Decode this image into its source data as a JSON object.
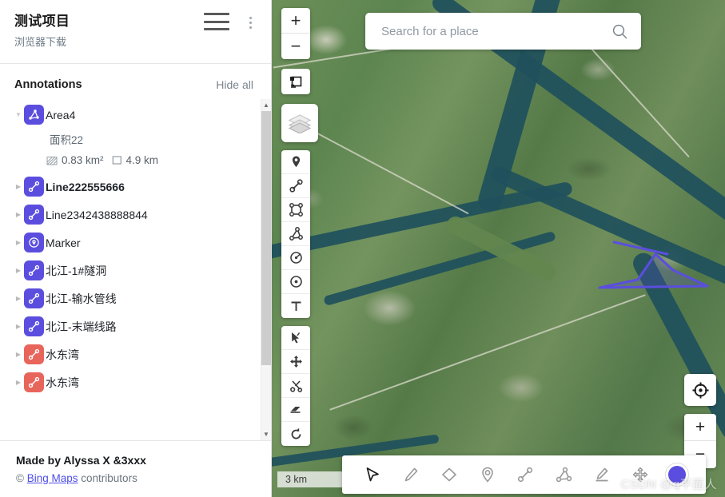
{
  "sidebar": {
    "project_title": "测试项目",
    "project_subtitle": "浏览器下载",
    "menu_icon": "hamburger-icon",
    "more_icon": "kebab-menu-icon",
    "annotations_heading": "Annotations",
    "hide_all_label": "Hide all",
    "items": [
      {
        "label": "Area4",
        "icon": "polygon-icon",
        "color": "#5b4ede",
        "expanded": true,
        "bold": false,
        "detail": {
          "note": "面积22",
          "area_value": "0.83 km²",
          "area_icon": "area-hatch-icon",
          "length_value": "4.9 km",
          "length_icon": "perimeter-square-icon"
        }
      },
      {
        "label": "Line222555666",
        "icon": "line-icon",
        "color": "#5b4ede",
        "expanded": false,
        "bold": true
      },
      {
        "label": "Line2342438888844",
        "icon": "line-icon",
        "color": "#5b4ede",
        "expanded": false,
        "bold": false
      },
      {
        "label": "Marker",
        "icon": "marker-pin-icon",
        "color": "#5b4ede",
        "expanded": false,
        "bold": false
      },
      {
        "label": "北江-1#隧洞",
        "icon": "line-icon",
        "color": "#5b4ede",
        "expanded": false,
        "bold": false
      },
      {
        "label": "北江-输水管线",
        "icon": "line-icon",
        "color": "#5b4ede",
        "expanded": false,
        "bold": false
      },
      {
        "label": "北江-末端线路",
        "icon": "line-icon",
        "color": "#5b4ede",
        "expanded": false,
        "bold": false
      },
      {
        "label": "水东湾",
        "icon": "line-icon",
        "color": "#e8655c",
        "expanded": false,
        "bold": false
      },
      {
        "label": "水东湾",
        "icon": "line-icon",
        "color": "#e8655c",
        "expanded": false,
        "bold": false
      }
    ],
    "footer": {
      "made_by": "Made by Alyssa X &3xxx",
      "copyright_symbol": "©",
      "provider_link": "Bing Maps",
      "contributors": "contributors"
    }
  },
  "map": {
    "search": {
      "placeholder": "Search for a place",
      "value": "",
      "icon": "search-icon"
    },
    "zoom_in_label": "+",
    "zoom_out_label": "−",
    "fit_icon": "fit-to-screen-icon",
    "layers_icon": "layers-stack-icon",
    "locate_icon": "locate-crosshair-icon",
    "scale_label": "3 km",
    "watermark": "CSDN @q平面人",
    "left_tools_group_a": [
      {
        "name": "marker-pin-tool",
        "title": "Marker"
      },
      {
        "name": "line-tool",
        "title": "Line"
      },
      {
        "name": "rectangle-tool",
        "title": "Rectangle"
      },
      {
        "name": "polygon-tool",
        "title": "Polygon"
      },
      {
        "name": "circle-radius-tool",
        "title": "Circle"
      },
      {
        "name": "point-circle-tool",
        "title": "Point"
      },
      {
        "name": "text-tool",
        "title": "Text"
      }
    ],
    "left_tools_group_b": [
      {
        "name": "pointer-select-tool",
        "title": "Select"
      },
      {
        "name": "move-tool",
        "title": "Move"
      },
      {
        "name": "scissors-cut-tool",
        "title": "Cut"
      },
      {
        "name": "eraser-tool",
        "title": "Erase"
      },
      {
        "name": "reload-tool",
        "title": "Reset"
      }
    ],
    "dock_tools": [
      {
        "name": "cursor-arrow-tool",
        "title": "Select"
      },
      {
        "name": "pencil-draw-tool",
        "title": "Draw"
      },
      {
        "name": "eraser-diamond-tool",
        "title": "Erase"
      },
      {
        "name": "marker-pin-tool",
        "title": "Marker"
      },
      {
        "name": "line-tool",
        "title": "Line"
      },
      {
        "name": "polygon-tool",
        "title": "Polygon"
      },
      {
        "name": "highlight-underline-tool",
        "title": "Highlight"
      },
      {
        "name": "move-tool",
        "title": "Move"
      }
    ],
    "color_swatch": "#5b4ede",
    "annotations_on_map": [
      {
        "type": "polygon",
        "stroke": "#5b4ede"
      },
      {
        "type": "line",
        "stroke": "#5b4ede"
      }
    ]
  }
}
